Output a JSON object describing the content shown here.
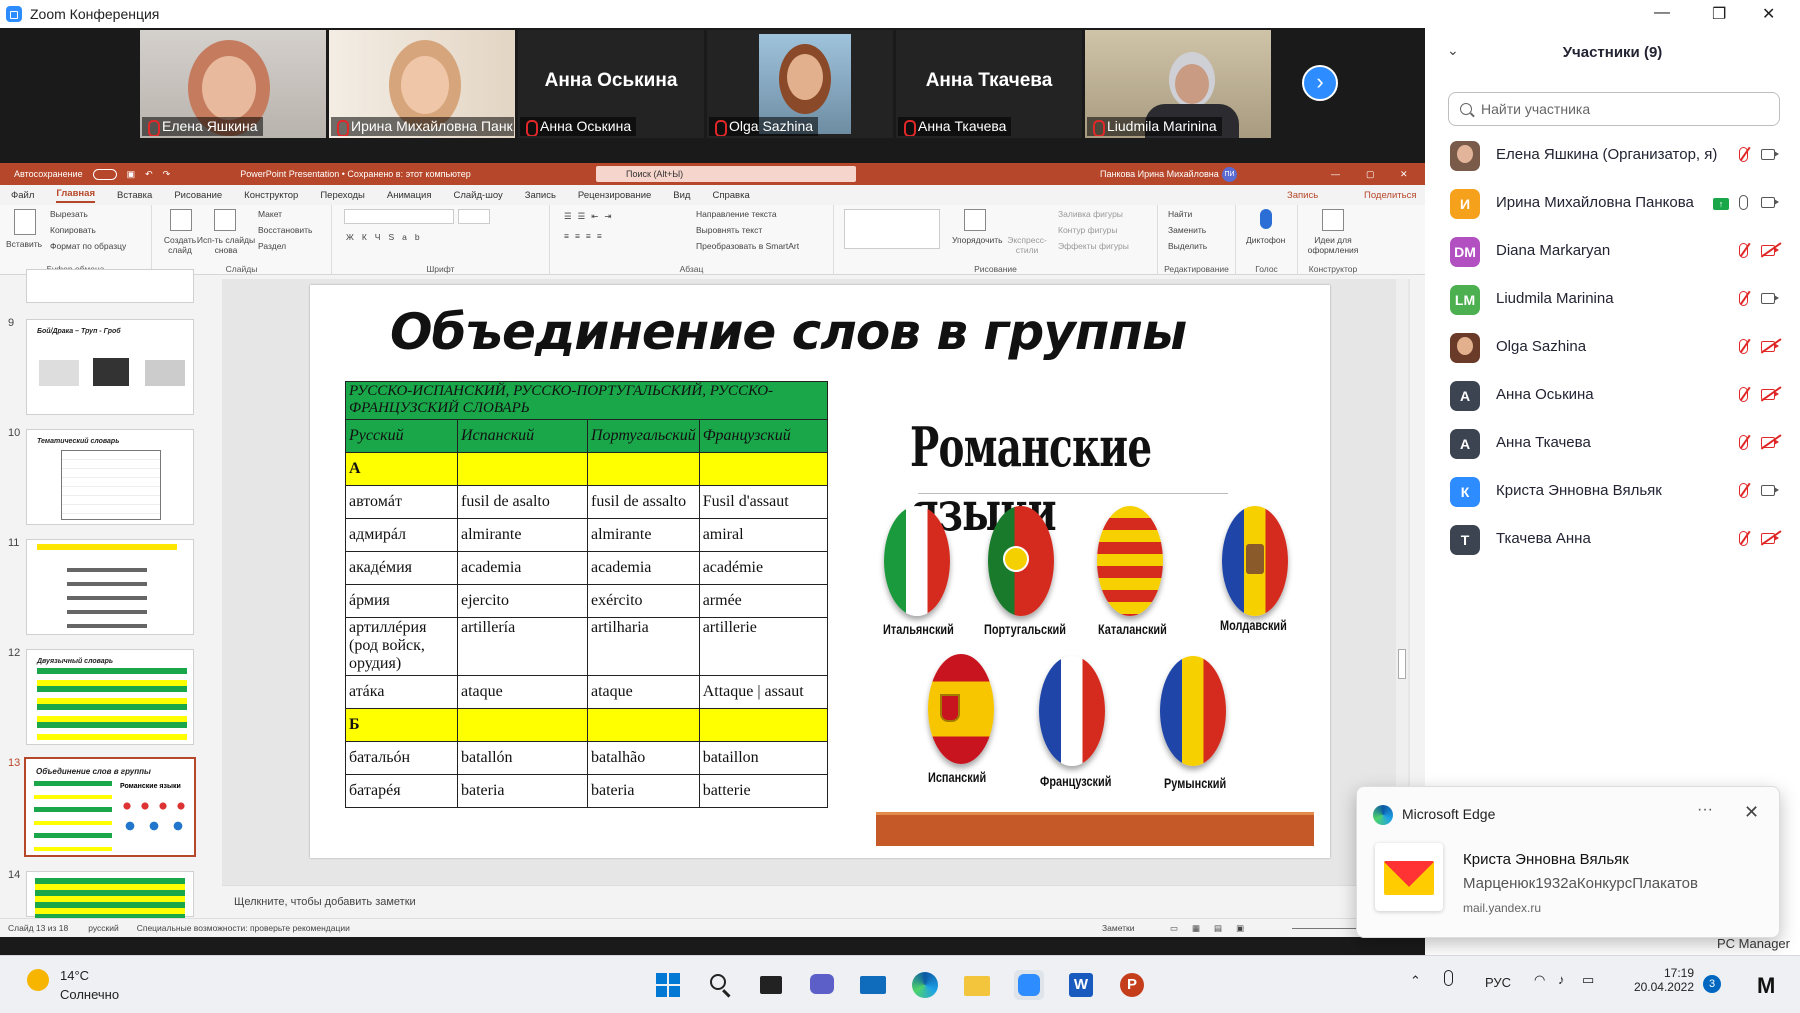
{
  "window": {
    "title": "Zoom Конференция"
  },
  "video_tiles": [
    {
      "name": "Елена Яшкина",
      "type": "video"
    },
    {
      "name": "Ирина Михайловна Панк...",
      "type": "video"
    },
    {
      "name": "Анна Оськина",
      "type": "name"
    },
    {
      "name": "Olga Sazhina",
      "type": "video"
    },
    {
      "name": "Анна Ткачева",
      "type": "name"
    },
    {
      "name": "Liudmila Marinina",
      "type": "video"
    }
  ],
  "ppt": {
    "autosave_label": "Автосохранение",
    "doc_status": "PowerPoint Presentation • Сохранено в: этот компьютер",
    "search_placeholder": "Поиск (Alt+Ы)",
    "user_name": "Панкова Ирина Михайловна",
    "user_initials": "ПИ",
    "tabs": [
      "Файл",
      "Главная",
      "Вставка",
      "Рисование",
      "Конструктор",
      "Переходы",
      "Анимация",
      "Слайд-шоу",
      "Запись",
      "Рецензирование",
      "Вид",
      "Справка"
    ],
    "record_btn": "Запись",
    "share_btn": "Поделиться",
    "ribbon": {
      "paste": "Вставить",
      "cut": "Вырезать",
      "copy": "Копировать",
      "format_painter": "Формат по образцу",
      "clipboard": "Буфер обмена",
      "new_slide": "Создать слайд",
      "reuse": "Исп-ть слайды снова",
      "layout": "Макет",
      "reset": "Восстановить",
      "section": "Раздел",
      "slides": "Слайды",
      "font": "Шрифт",
      "paragraph": "Абзац",
      "text_dir": "Направление текста",
      "align_text": "Выровнять текст",
      "smartart": "Преобразовать в SmartArt",
      "arrange": "Упорядочить",
      "quick_styles": "Экспресс-стили",
      "fill": "Заливка фигуры",
      "outline": "Контур фигуры",
      "effects": "Эффекты фигуры",
      "drawing": "Рисование",
      "find": "Найти",
      "replace": "Заменить",
      "select": "Выделить",
      "editing": "Редактирование",
      "dictate": "Диктофон",
      "voice": "Голос",
      "designer_ideas": "Идеи для оформления",
      "designer": "Конструктор"
    },
    "thumbnails": [
      {
        "num": "9",
        "title": "Бой/Драка – Труп - Гроб"
      },
      {
        "num": "10",
        "title": "Тематический словарь"
      },
      {
        "num": "11",
        "title": ""
      },
      {
        "num": "12",
        "title": "Двуязычный словарь"
      },
      {
        "num": "13",
        "title": "Объединение слов в группы",
        "selected": true
      },
      {
        "num": "14",
        "title": ""
      }
    ],
    "notes_placeholder": "Щелкните, чтобы добавить заметки",
    "status": {
      "slide": "Слайд 13 из 18",
      "lang": "русский",
      "accessibility": "Специальные возможности: проверьте рекомендации",
      "notes_btn": "Заметки"
    }
  },
  "slide": {
    "title": "Объединение слов в группы",
    "table": {
      "title": "РУССКО-ИСПАНСКИЙ, РУССКО-ПОРТУГАЛЬСКИЙ, РУССКО-ФРАНЦУЗСКИЙ СЛОВАРЬ",
      "headers": [
        "Русский",
        "Испанский",
        "Португальский",
        "Французский"
      ],
      "rows": [
        {
          "letter": "А"
        },
        {
          "cells": [
            "автомáт",
            "fusil de asalto",
            "fusil de assalto",
            "Fusil d'assaut"
          ]
        },
        {
          "cells": [
            "адмирáл",
            "almirante",
            "almirante",
            "amiral"
          ]
        },
        {
          "cells": [
            "акадéмия",
            "academia",
            "academia",
            "académie"
          ]
        },
        {
          "cells": [
            "áрмия",
            "ejercito",
            "exército",
            "armée"
          ]
        },
        {
          "cells": [
            "артиллéрия (род войск, орудия)",
            "artillería",
            "artilharia",
            "artillerie"
          ]
        },
        {
          "cells": [
            "атáка",
            "ataque",
            "ataque",
            "Attaque | assaut"
          ]
        },
        {
          "letter": "Б"
        },
        {
          "cells": [
            "батальóн",
            "batallón",
            "batalhão",
            "bataillon"
          ]
        },
        {
          "cells": [
            "батарéя",
            "bateria",
            "bateria",
            "batterie"
          ]
        }
      ]
    },
    "right_title": "Романские языки",
    "flags": [
      {
        "label": "Итальянский",
        "icon": "italy-flag-icon"
      },
      {
        "label": "Португальский",
        "icon": "portugal-flag-icon"
      },
      {
        "label": "Каталанский",
        "icon": "catalonia-flag-icon"
      },
      {
        "label": "Молдавский",
        "icon": "moldova-flag-icon"
      },
      {
        "label": "Испанский",
        "icon": "spain-flag-icon"
      },
      {
        "label": "Французский",
        "icon": "france-flag-icon"
      },
      {
        "label": "Румынский",
        "icon": "romania-flag-icon"
      }
    ]
  },
  "participants": {
    "header": "Участники (9)",
    "search_placeholder": "Найти участника",
    "list": [
      {
        "name": "Елена Яшкина (Организатор, я)",
        "initials": "",
        "color": "#7a5a48",
        "mic": "off",
        "cam": "on"
      },
      {
        "name": "Ирина Михайловна Панкова",
        "initials": "И",
        "color": "#f5a11c",
        "mic": "on",
        "cam": "on",
        "sharing": true
      },
      {
        "name": "Diana Markaryan",
        "initials": "DM",
        "color": "#b24fc1",
        "mic": "off",
        "cam": "off"
      },
      {
        "name": "Liudmila Marinina",
        "initials": "LM",
        "color": "#4caf50",
        "mic": "off",
        "cam": "on"
      },
      {
        "name": "Olga Sazhina",
        "initials": "",
        "color": "#6b3b2a",
        "mic": "off",
        "cam": "off"
      },
      {
        "name": "Анна Оськина",
        "initials": "А",
        "color": "#3d4451",
        "mic": "off",
        "cam": "off"
      },
      {
        "name": "Анна Ткачева",
        "initials": "А",
        "color": "#3d4451",
        "mic": "off",
        "cam": "off"
      },
      {
        "name": "Криста Энновна Вяльяк",
        "initials": "К",
        "color": "#2d8cff",
        "mic": "off",
        "cam": "on"
      },
      {
        "name": "Ткачева Анна",
        "initials": "Т",
        "color": "#3d4451",
        "mic": "off",
        "cam": "off"
      }
    ]
  },
  "notification": {
    "app": "Microsoft Edge",
    "sender": "Криста Энновна Вяльяк",
    "subject": "Марценюк1932аКонкурсПлакатов",
    "source": "mail.yandex.ru"
  },
  "pc_manager": "PC Manager",
  "taskbar": {
    "temp": "14°C",
    "weather": "Солнечно",
    "lang": "РУС",
    "time": "17:19",
    "date": "20.04.2022",
    "badge": "3"
  },
  "colors": {
    "ppt_accent": "#b7472a",
    "zoom_blue": "#2d8cff",
    "table_green": "#1aa74a",
    "table_yellow": "#ffff00"
  }
}
